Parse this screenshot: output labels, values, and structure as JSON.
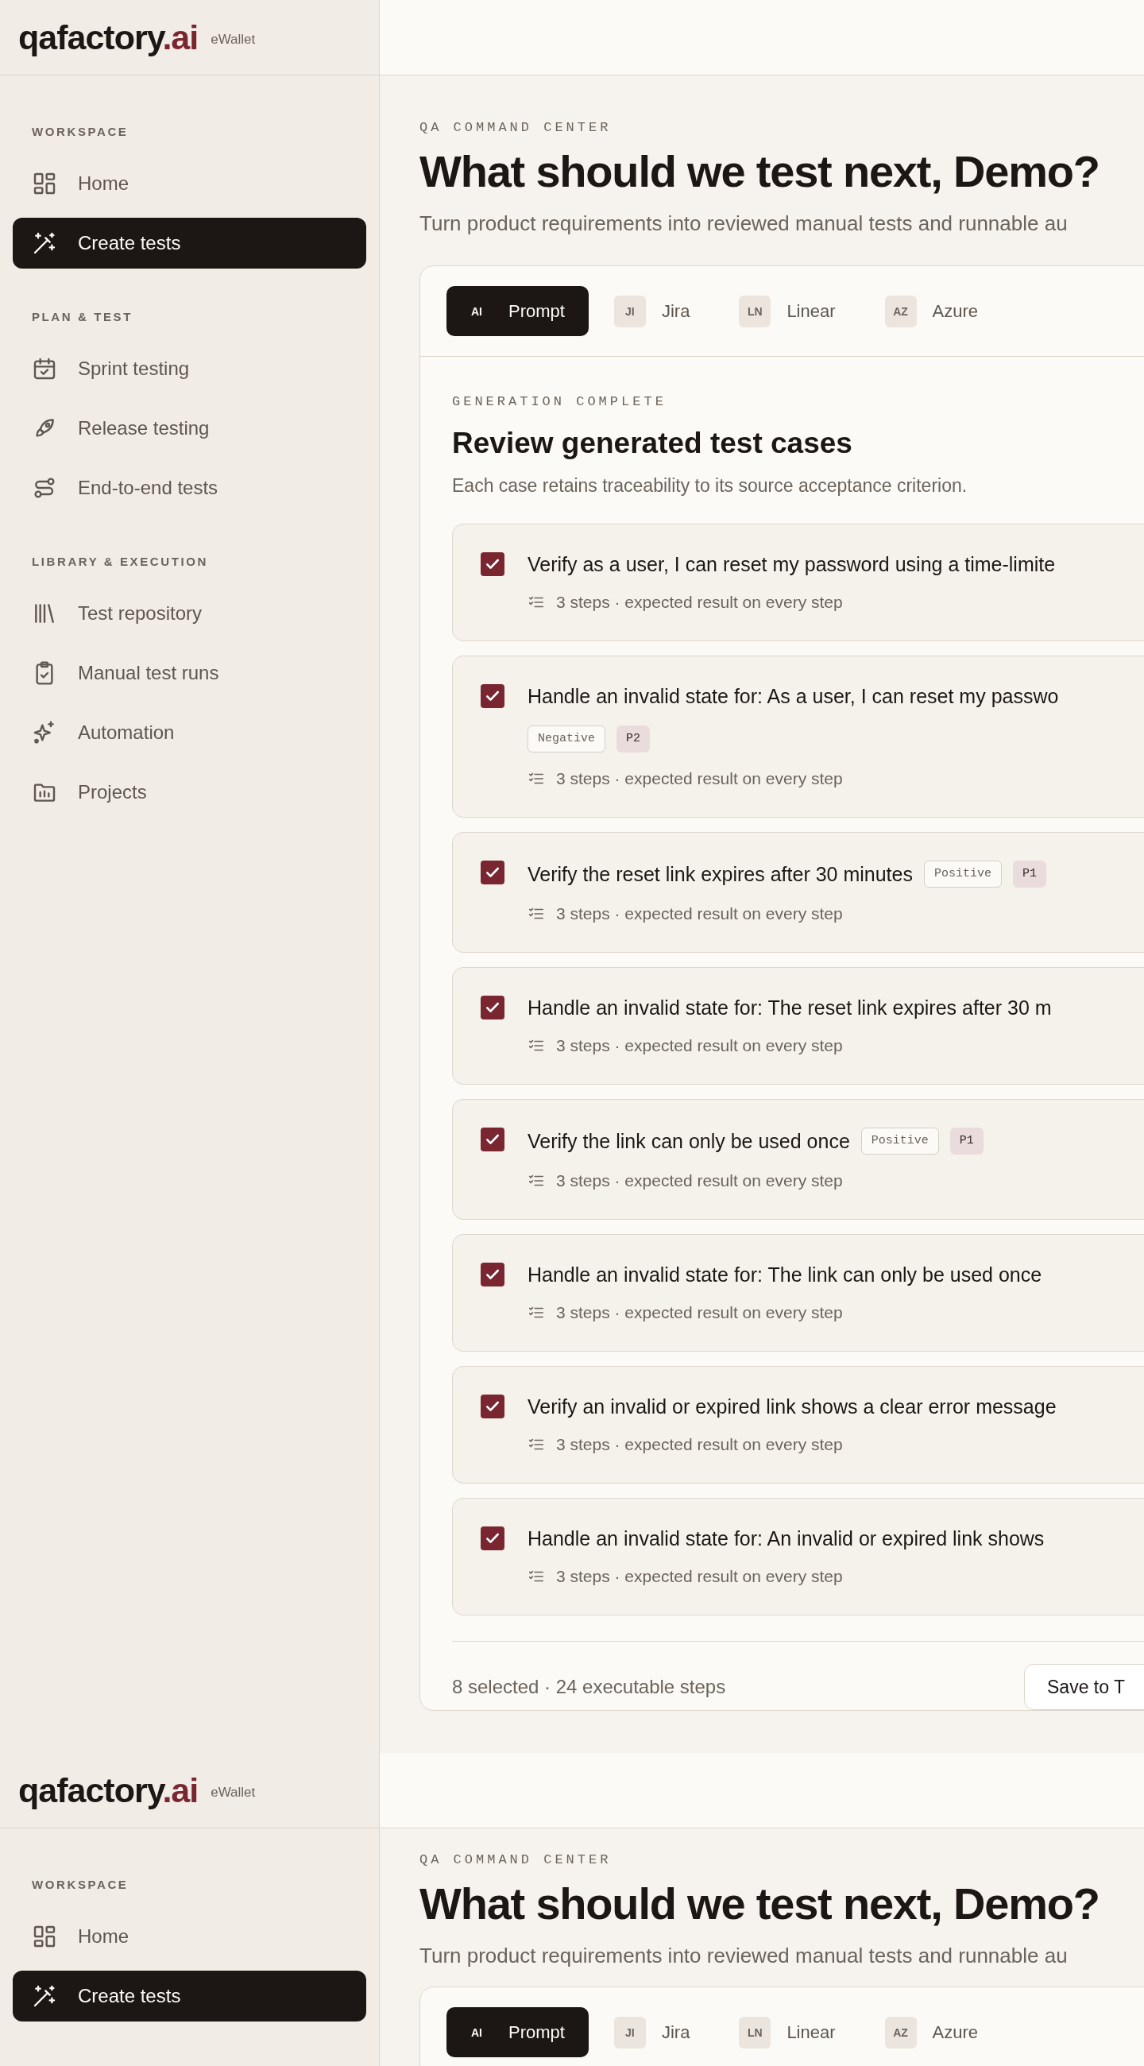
{
  "captures": [
    {
      "header": {
        "logo": "qafactory",
        "logo_suffix": ".ai",
        "workspace": "eWallet"
      },
      "sidebar": {
        "sections": [
          {
            "title": "WORKSPACE",
            "items": [
              {
                "label": "Home",
                "selected": false
              },
              {
                "label": "Create tests",
                "selected": true
              }
            ]
          },
          {
            "title": "PLAN & TEST",
            "items": [
              {
                "label": "Sprint testing",
                "selected": false
              },
              {
                "label": "Release testing",
                "selected": false
              },
              {
                "label": "End-to-end tests",
                "selected": false
              }
            ]
          },
          {
            "title": "LIBRARY & EXECUTION",
            "items": [
              {
                "label": "Test repository",
                "selected": false
              },
              {
                "label": "Manual test runs",
                "selected": false
              },
              {
                "label": "Automation",
                "selected": false
              },
              {
                "label": "Projects",
                "selected": false
              }
            ]
          }
        ]
      },
      "main": {
        "eyebrow": "QA COMMAND CENTER",
        "heading": "What should we test next, Demo?",
        "subtitle": "Turn product requirements into reviewed manual tests and runnable au",
        "tabs": [
          {
            "badge": "AI",
            "label": "Prompt",
            "selected": true
          },
          {
            "badge": "JI",
            "label": "Jira",
            "selected": false
          },
          {
            "badge": "LN",
            "label": "Linear",
            "selected": false
          },
          {
            "badge": "AZ",
            "label": "Azure",
            "selected": false
          }
        ],
        "review": {
          "eyebrow": "GENERATION COMPLETE",
          "title": "Review generated test cases",
          "description": "Each case retains traceability to its source acceptance criterion.",
          "cases": [
            {
              "title": "Verify as a user, I can reset my password using a time-limite",
              "checked": true,
              "meta": "3 steps · expected result on every step"
            },
            {
              "title": "Handle an invalid state for: As a user, I can reset my passwo",
              "checked": true,
              "tags": [
                {
                  "label": "Negative",
                  "kind": "type"
                },
                {
                  "label": "P2",
                  "kind": "priority"
                }
              ],
              "meta": "3 steps · expected result on every step"
            },
            {
              "title": "Verify the reset link expires after 30 minutes",
              "checked": true,
              "tags": [
                {
                  "label": "Positive",
                  "kind": "type"
                },
                {
                  "label": "P1",
                  "kind": "priority"
                }
              ],
              "meta": "3 steps · expected result on every step"
            },
            {
              "title": "Handle an invalid state for: The reset link expires after 30 m",
              "checked": true,
              "meta": "3 steps · expected result on every step"
            },
            {
              "title": "Verify the link can only be used once",
              "checked": true,
              "tags": [
                {
                  "label": "Positive",
                  "kind": "type"
                },
                {
                  "label": "P1",
                  "kind": "priority"
                }
              ],
              "meta": "3 steps · expected result on every step"
            },
            {
              "title": "Handle an invalid state for: The link can only be used once",
              "checked": true,
              "meta": "3 steps · expected result on every step"
            },
            {
              "title": "Verify an invalid or expired link shows a clear error message",
              "checked": true,
              "meta": "3 steps · expected result on every step"
            },
            {
              "title": "Handle an invalid state for: An invalid or expired link shows",
              "checked": true,
              "meta": "3 steps · expected result on every step"
            }
          ],
          "summary": "8 selected · 24 executable steps",
          "save_button": "Save to T"
        }
      }
    },
    {
      "header": {
        "logo": "qafactory",
        "logo_suffix": ".ai",
        "workspace": "eWallet"
      },
      "sidebar": {
        "sections": [
          {
            "title": "WORKSPACE",
            "items": [
              {
                "label": "Home",
                "selected": false
              },
              {
                "label": "Create tests",
                "selected": true
              }
            ]
          }
        ]
      },
      "main": {
        "eyebrow": "QA COMMAND CENTER",
        "heading": "What should we test next, Demo?",
        "subtitle": "Turn product requirements into reviewed manual tests and runnable au",
        "tabs": [
          {
            "badge": "AI",
            "label": "Prompt",
            "selected": true
          },
          {
            "badge": "JI",
            "label": "Jira",
            "selected": false
          },
          {
            "badge": "LN",
            "label": "Linear",
            "selected": false
          },
          {
            "badge": "AZ",
            "label": "Azure",
            "selected": false
          }
        ]
      }
    }
  ]
}
